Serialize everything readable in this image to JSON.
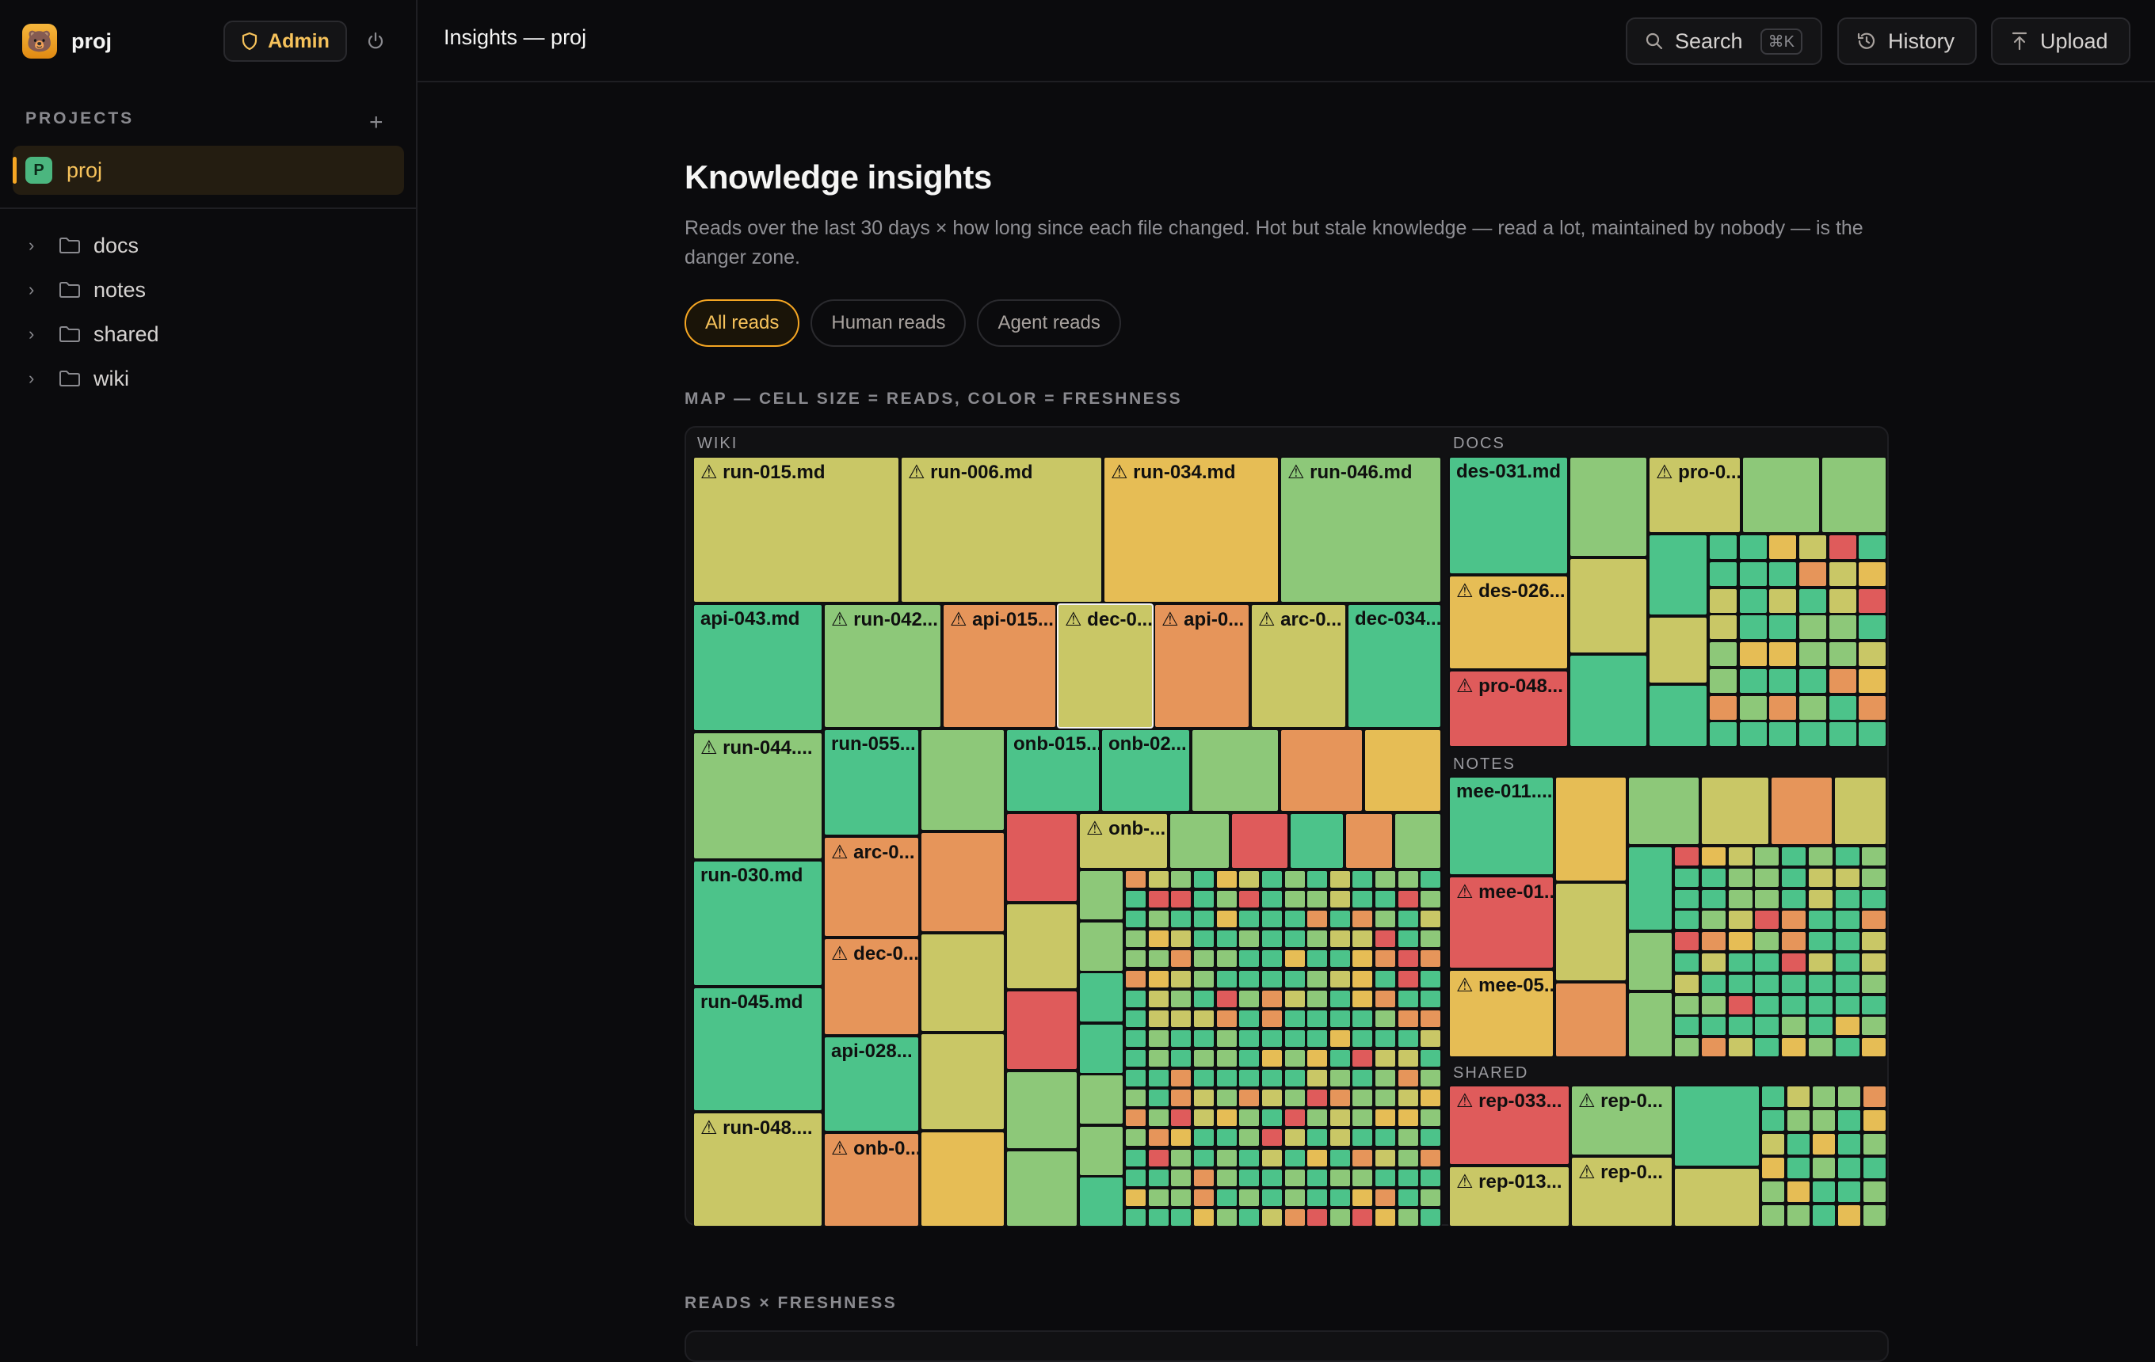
{
  "app": {
    "name": "proj",
    "admin_label": "Admin"
  },
  "sidebar": {
    "projects_heading": "PROJECTS",
    "add_symbol": "+",
    "active_project": {
      "badge": "P",
      "label": "proj"
    },
    "tree": [
      {
        "label": "docs"
      },
      {
        "label": "notes"
      },
      {
        "label": "shared"
      },
      {
        "label": "wiki"
      }
    ]
  },
  "topbar": {
    "breadcrumb": "Insights — proj",
    "search_label": "Search",
    "search_shortcut": "⌘K",
    "history_label": "History",
    "upload_label": "Upload"
  },
  "main": {
    "title": "Knowledge insights",
    "subtitle": "Reads over the last 30 days × how long since each file changed. Hot but stale knowledge — read a lot, maintained by nobody — is the danger zone.",
    "filters": [
      "All reads",
      "Human reads",
      "Agent reads"
    ],
    "active_filter": "All reads",
    "map_heading": "MAP — CELL SIZE = READS, COLOR = FRESHNESS",
    "second_heading": "READS × FRESHNESS"
  },
  "colors": {
    "green": "#4cc38a",
    "lightgreen": "#8dc879",
    "olive": "#c9c766",
    "yellow": "#e6bd55",
    "orange": "#e6955a",
    "red": "#df5b5b",
    "accent": "#f5a623"
  },
  "treemap": {
    "groups": [
      "WIKI",
      "DOCS",
      "NOTES",
      "SHARED"
    ],
    "labeled_cells": [
      {
        "group": "WIKI",
        "label": "run-015.md",
        "warn": true,
        "color": "olive"
      },
      {
        "group": "WIKI",
        "label": "run-006.md",
        "warn": true,
        "color": "olive"
      },
      {
        "group": "WIKI",
        "label": "run-034.md",
        "warn": true,
        "color": "yellow"
      },
      {
        "group": "WIKI",
        "label": "run-046.md",
        "warn": true,
        "color": "lightgreen"
      },
      {
        "group": "WIKI",
        "label": "api-043.md",
        "warn": false,
        "color": "green"
      },
      {
        "group": "WIKI",
        "label": "run-042...",
        "warn": true,
        "color": "lightgreen"
      },
      {
        "group": "WIKI",
        "label": "api-015...",
        "warn": true,
        "color": "orange"
      },
      {
        "group": "WIKI",
        "label": "dec-0...",
        "warn": true,
        "color": "olive"
      },
      {
        "group": "WIKI",
        "label": "api-0...",
        "warn": true,
        "color": "orange"
      },
      {
        "group": "WIKI",
        "label": "arc-0...",
        "warn": true,
        "color": "olive"
      },
      {
        "group": "WIKI",
        "label": "dec-034...",
        "warn": false,
        "color": "green"
      },
      {
        "group": "WIKI",
        "label": "run-044....",
        "warn": true,
        "color": "lightgreen"
      },
      {
        "group": "WIKI",
        "label": "run-055...",
        "warn": false,
        "color": "green"
      },
      {
        "group": "WIKI",
        "label": "onb-015...",
        "warn": false,
        "color": "green"
      },
      {
        "group": "WIKI",
        "label": "onb-02...",
        "warn": false,
        "color": "green"
      },
      {
        "group": "WIKI",
        "label": "onb-...",
        "warn": true,
        "color": "olive"
      },
      {
        "group": "WIKI",
        "label": "arc-0...",
        "warn": true,
        "color": "orange"
      },
      {
        "group": "WIKI",
        "label": "run-030.md",
        "warn": false,
        "color": "green"
      },
      {
        "group": "WIKI",
        "label": "dec-0...",
        "warn": true,
        "color": "orange"
      },
      {
        "group": "WIKI",
        "label": "run-045.md",
        "warn": false,
        "color": "green"
      },
      {
        "group": "WIKI",
        "label": "api-028...",
        "warn": false,
        "color": "green"
      },
      {
        "group": "WIKI",
        "label": "run-048....",
        "warn": true,
        "color": "olive"
      },
      {
        "group": "WIKI",
        "label": "onb-0...",
        "warn": true,
        "color": "orange"
      },
      {
        "group": "DOCS",
        "label": "des-031.md",
        "warn": false,
        "color": "green"
      },
      {
        "group": "DOCS",
        "label": "pro-0...",
        "warn": true,
        "color": "olive"
      },
      {
        "group": "DOCS",
        "label": "des-026...",
        "warn": true,
        "color": "yellow"
      },
      {
        "group": "DOCS",
        "label": "pro-048...",
        "warn": true,
        "color": "red"
      },
      {
        "group": "NOTES",
        "label": "mee-011....",
        "warn": false,
        "color": "green"
      },
      {
        "group": "NOTES",
        "label": "mee-01...",
        "warn": true,
        "color": "red"
      },
      {
        "group": "NOTES",
        "label": "mee-05...",
        "warn": true,
        "color": "yellow"
      },
      {
        "group": "SHARED",
        "label": "rep-033...",
        "warn": true,
        "color": "red"
      },
      {
        "group": "SHARED",
        "label": "rep-0...",
        "warn": true,
        "color": "lightgreen"
      },
      {
        "group": "SHARED",
        "label": "rep-013...",
        "warn": true,
        "color": "olive"
      },
      {
        "group": "SHARED",
        "label": "rep-0...",
        "warn": true,
        "color": "olive"
      }
    ]
  }
}
